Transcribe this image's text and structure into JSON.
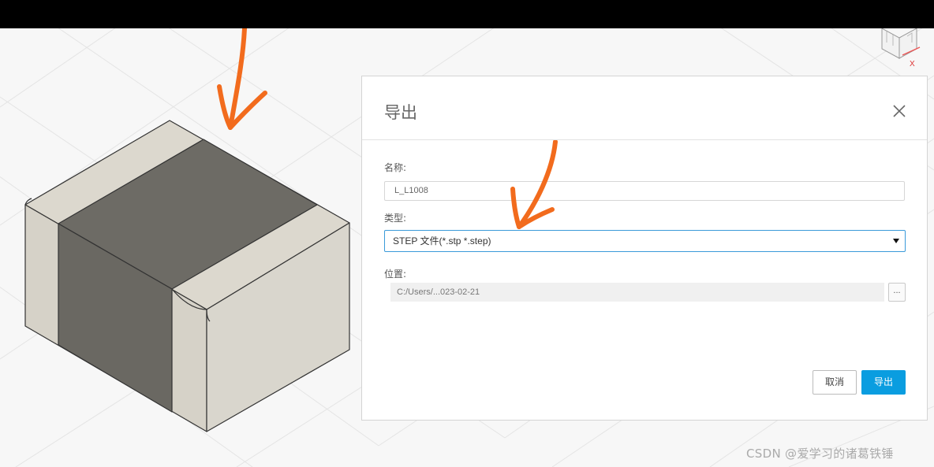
{
  "dialog": {
    "title": "导出",
    "name_label": "名称:",
    "name_value": "L_L1008",
    "type_label": "类型:",
    "type_value": "STEP 文件(*.stp *.step)",
    "location_label": "位置:",
    "location_value": "C:/Users/...023-02-21",
    "browse_label": "...",
    "cancel_label": "取消",
    "export_label": "导出"
  },
  "viewcube": {
    "axis_label": "X"
  },
  "watermark": "CSDN @爱学习的诸葛铁锤",
  "colors": {
    "accent": "#0a9de0",
    "annotation": "#f26b1d",
    "component_end": "#d6d2c8",
    "component_body": "#6a6862"
  }
}
